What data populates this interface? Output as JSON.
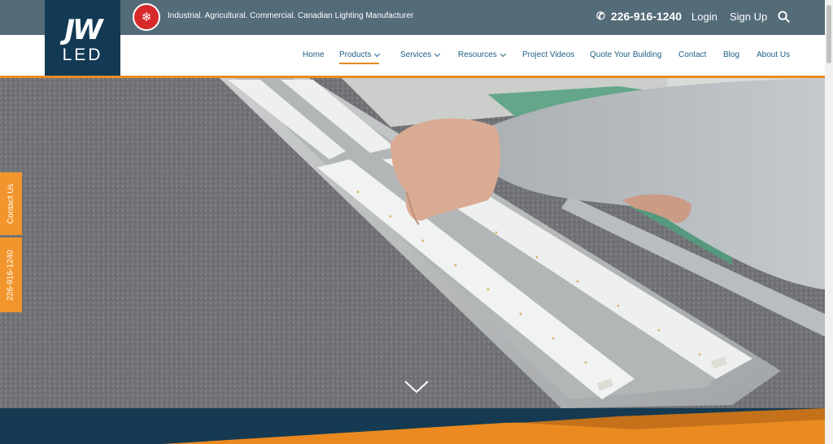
{
  "header": {
    "logo_top": "JW",
    "logo_bottom": "LED",
    "tagline": "Industrial. Agricultural. Commercial. Canadian Lighting Manufacturer",
    "phone": "226-916-1240",
    "login_label": "Login",
    "signup_label": "Sign Up"
  },
  "nav": {
    "items": [
      {
        "label": "Home"
      },
      {
        "label": "Products"
      },
      {
        "label": "Services"
      },
      {
        "label": "Resources"
      },
      {
        "label": "Project Videos"
      },
      {
        "label": "Quote Your Building"
      },
      {
        "label": "Contact"
      },
      {
        "label": "Blog"
      },
      {
        "label": "About Us"
      }
    ]
  },
  "side_tabs": {
    "contact": "Contact Us",
    "phone": "226-916-1240"
  },
  "colors": {
    "topbar": "#546b78",
    "logo_bg": "#133a54",
    "accent_orange": "#ea8a21",
    "nav_text": "#1e5f85",
    "band": "#153a52"
  },
  "icons": [
    "phone-icon",
    "search-icon",
    "chevron-down-icon",
    "canada-badge-icon",
    "maple-leaf-icon"
  ]
}
